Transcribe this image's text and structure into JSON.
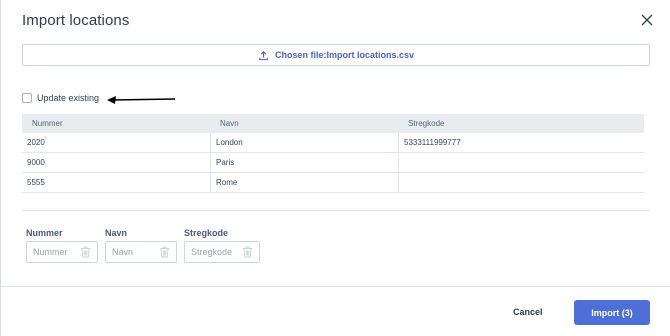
{
  "dialog": {
    "title": "Import locations",
    "close_icon": "close-icon"
  },
  "file": {
    "label": "Chosen file:Import locations.csv",
    "icon": "upload-icon"
  },
  "update_existing": {
    "label": "Update existing",
    "checked": false
  },
  "table": {
    "headers": [
      "Nummer",
      "Navn",
      "Stregkode"
    ],
    "rows": [
      [
        "2020",
        "London",
        "5333111999777"
      ],
      [
        "9000",
        "Paris",
        ""
      ],
      [
        "5555",
        "Rome",
        ""
      ]
    ]
  },
  "filters": [
    {
      "label": "Nummer",
      "placeholder": "Nummer"
    },
    {
      "label": "Navn",
      "placeholder": "Navn"
    },
    {
      "label": "Stregkode",
      "placeholder": "Stregkode"
    }
  ],
  "footer": {
    "cancel_label": "Cancel",
    "import_label": "Import (3)"
  },
  "colors": {
    "primary": "#4f6fd8",
    "link": "#4c63c8"
  }
}
